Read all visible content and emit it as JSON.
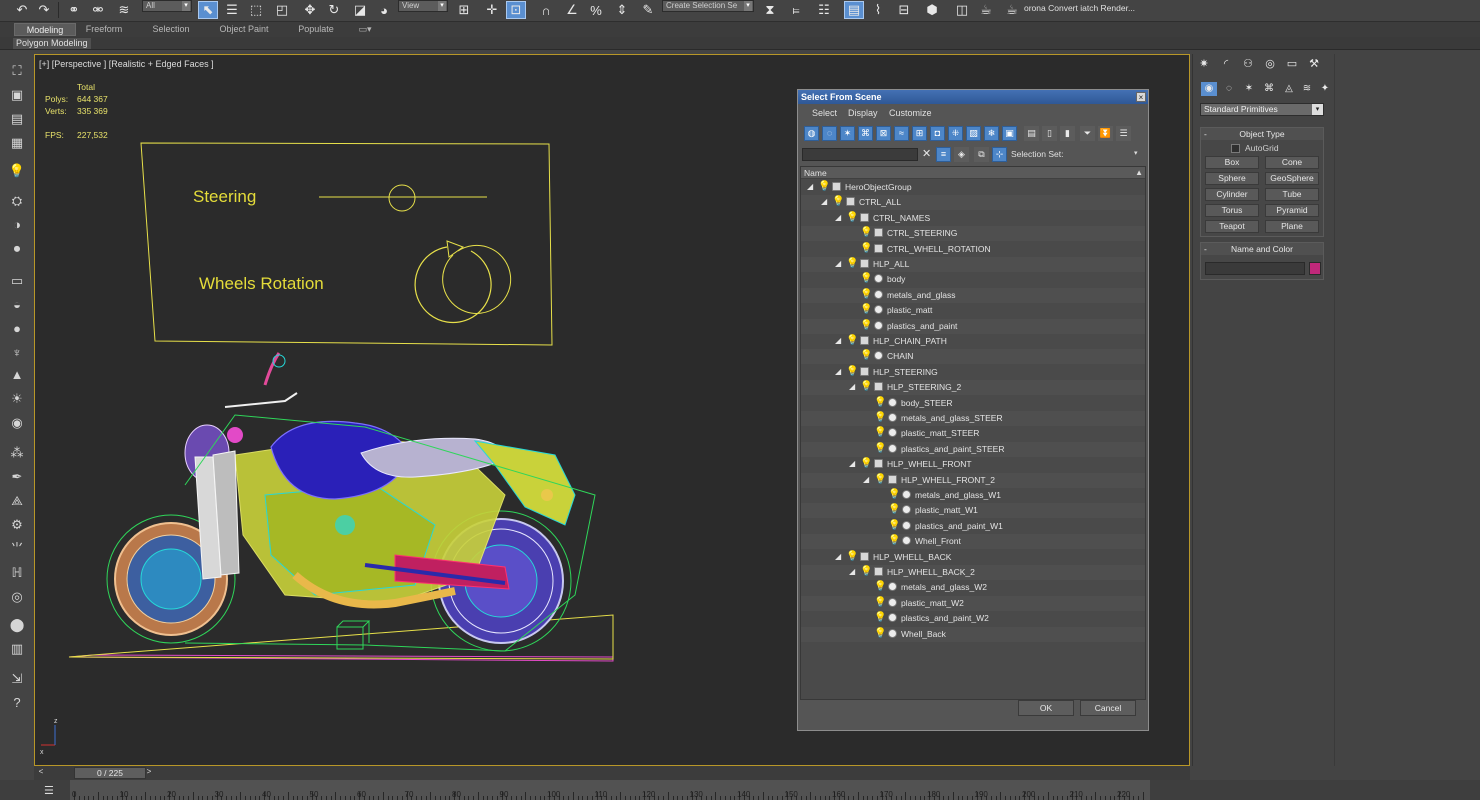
{
  "toolbar": {
    "selection_filter": "All",
    "reference_coord": "View",
    "named_selection": "Create Selection Se",
    "render_label": "orona Convert iatch Render..."
  },
  "ribbon": {
    "tabs": [
      {
        "label": "Modeling",
        "active": true
      },
      {
        "label": "Freeform",
        "active": false
      },
      {
        "label": "Selection",
        "active": false
      },
      {
        "label": "Object Paint",
        "active": false
      },
      {
        "label": "Populate",
        "active": false
      }
    ],
    "sub_label": "Polygon Modeling"
  },
  "viewport": {
    "label": "[+] [Perspective ] [Realistic + Edged Faces ]",
    "stats": {
      "header": "Total",
      "polys_label": "Polys:",
      "polys_value": "644 367",
      "verts_label": "Verts:",
      "verts_value": "335 369",
      "fps_label": "FPS:",
      "fps_value": "227,532"
    },
    "control_panel": {
      "steering_label": "Steering",
      "wheels_label": "Wheels Rotation"
    },
    "axis": {
      "z": "z",
      "x": "x"
    }
  },
  "dialog": {
    "title": "Select From Scene",
    "close": "×",
    "menu": [
      "Select",
      "Display",
      "Customize"
    ],
    "selection_set_label": "Selection Set:",
    "column_header": "Name",
    "ok_label": "OK",
    "cancel_label": "Cancel",
    "tree": [
      {
        "name": "HeroObjectGroup",
        "depth": 0,
        "kind": "helper"
      },
      {
        "name": "CTRL_ALL",
        "depth": 1,
        "kind": "helper"
      },
      {
        "name": "CTRL_NAMES",
        "depth": 2,
        "kind": "helper"
      },
      {
        "name": "CTRL_STEERING",
        "depth": 3,
        "kind": "helper"
      },
      {
        "name": "CTRL_WHELL_ROTATION",
        "depth": 3,
        "kind": "helper"
      },
      {
        "name": "HLP_ALL",
        "depth": 2,
        "kind": "helper"
      },
      {
        "name": "body",
        "depth": 3,
        "kind": "mesh"
      },
      {
        "name": "metals_and_glass",
        "depth": 3,
        "kind": "mesh"
      },
      {
        "name": "plastic_matt",
        "depth": 3,
        "kind": "mesh"
      },
      {
        "name": "plastics_and_paint",
        "depth": 3,
        "kind": "mesh"
      },
      {
        "name": "HLP_CHAIN_PATH",
        "depth": 2,
        "kind": "helper"
      },
      {
        "name": "CHAIN",
        "depth": 3,
        "kind": "mesh"
      },
      {
        "name": "HLP_STEERING",
        "depth": 2,
        "kind": "helper"
      },
      {
        "name": "HLP_STEERING_2",
        "depth": 3,
        "kind": "helper"
      },
      {
        "name": "body_STEER",
        "depth": 4,
        "kind": "mesh"
      },
      {
        "name": "metals_and_glass_STEER",
        "depth": 4,
        "kind": "mesh"
      },
      {
        "name": "plastic_matt_STEER",
        "depth": 4,
        "kind": "mesh"
      },
      {
        "name": "plastics_and_paint_STEER",
        "depth": 4,
        "kind": "mesh"
      },
      {
        "name": "HLP_WHELL_FRONT",
        "depth": 3,
        "kind": "helper"
      },
      {
        "name": "HLP_WHELL_FRONT_2",
        "depth": 4,
        "kind": "helper"
      },
      {
        "name": "metals_and_glass_W1",
        "depth": 5,
        "kind": "mesh"
      },
      {
        "name": "plastic_matt_W1",
        "depth": 5,
        "kind": "mesh"
      },
      {
        "name": "plastics_and_paint_W1",
        "depth": 5,
        "kind": "mesh"
      },
      {
        "name": "Whell_Front",
        "depth": 5,
        "kind": "mesh"
      },
      {
        "name": "HLP_WHELL_BACK",
        "depth": 2,
        "kind": "helper"
      },
      {
        "name": "HLP_WHELL_BACK_2",
        "depth": 3,
        "kind": "helper"
      },
      {
        "name": "metals_and_glass_W2",
        "depth": 4,
        "kind": "mesh"
      },
      {
        "name": "plastic_matt_W2",
        "depth": 4,
        "kind": "mesh"
      },
      {
        "name": "plastics_and_paint_W2",
        "depth": 4,
        "kind": "mesh"
      },
      {
        "name": "Whell_Back",
        "depth": 4,
        "kind": "mesh"
      }
    ]
  },
  "command_panel": {
    "dropdown": "Standard Primitives",
    "object_type": {
      "title": "Object Type",
      "autogrid": "AutoGrid",
      "buttons": [
        "Box",
        "Cone",
        "Sphere",
        "GeoSphere",
        "Cylinder",
        "Tube",
        "Torus",
        "Pyramid",
        "Teapot",
        "Plane"
      ]
    },
    "name_color": {
      "title": "Name and Color",
      "color": "#c0287a"
    }
  },
  "timeline": {
    "position": "0 / 225",
    "ruler_labels": [
      "0",
      "10",
      "20",
      "30",
      "40",
      "50",
      "60",
      "70",
      "80",
      "90",
      "100",
      "110",
      "120",
      "130",
      "140",
      "150",
      "160",
      "170",
      "180",
      "190",
      "200",
      "210",
      "220"
    ]
  },
  "colors": {
    "viewport_border": "#b89728",
    "selected_tool": "#5a8fd0",
    "dialog_title": "#3a64a6"
  }
}
